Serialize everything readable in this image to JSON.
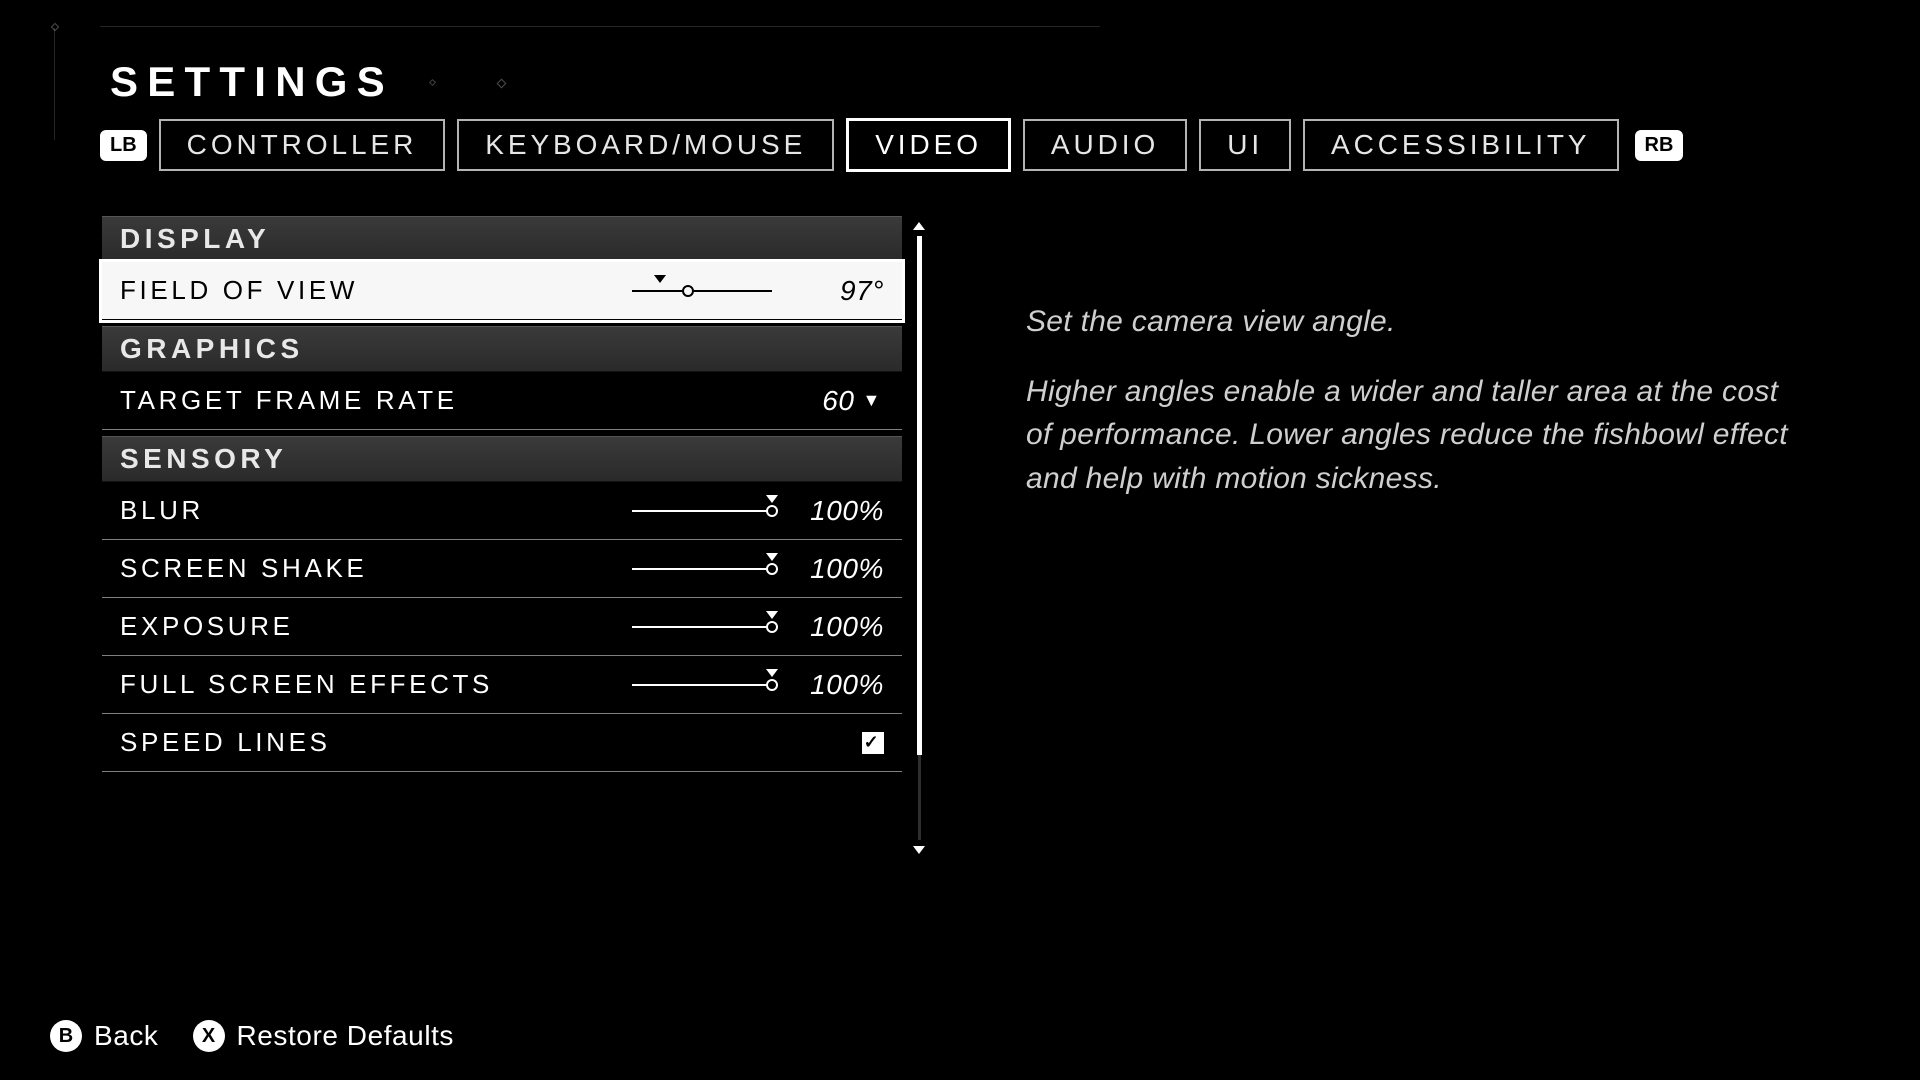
{
  "title": "SETTINGS",
  "bumpers": {
    "left": "LB",
    "right": "RB"
  },
  "tabs": [
    {
      "label": "CONTROLLER",
      "active": false
    },
    {
      "label": "KEYBOARD/MOUSE",
      "active": false
    },
    {
      "label": "VIDEO",
      "active": true
    },
    {
      "label": "AUDIO",
      "active": false
    },
    {
      "label": "UI",
      "active": false
    },
    {
      "label": "ACCESSIBILITY",
      "active": false
    }
  ],
  "sections": {
    "display": {
      "header": "DISPLAY",
      "fov": {
        "label": "FIELD OF VIEW",
        "value": "97°",
        "percent": 40
      }
    },
    "graphics": {
      "header": "GRAPHICS",
      "target_fps": {
        "label": "TARGET FRAME RATE",
        "value": "60"
      }
    },
    "sensory": {
      "header": "SENSORY",
      "blur": {
        "label": "BLUR",
        "value": "100%",
        "percent": 100
      },
      "shake": {
        "label": "SCREEN SHAKE",
        "value": "100%",
        "percent": 100
      },
      "exposure": {
        "label": "EXPOSURE",
        "value": "100%",
        "percent": 100
      },
      "fse": {
        "label": "FULL SCREEN EFFECTS",
        "value": "100%",
        "percent": 100
      },
      "speedlines": {
        "label": "SPEED LINES",
        "checked": true
      }
    }
  },
  "description": {
    "line1": "Set the camera view angle.",
    "line2": "Higher angles enable a wider and taller area at the cost of performance. Lower angles reduce the fishbowl effect and help with motion sickness."
  },
  "footer": {
    "back": {
      "key": "B",
      "label": "Back"
    },
    "restore": {
      "key": "X",
      "label": "Restore Defaults"
    }
  }
}
